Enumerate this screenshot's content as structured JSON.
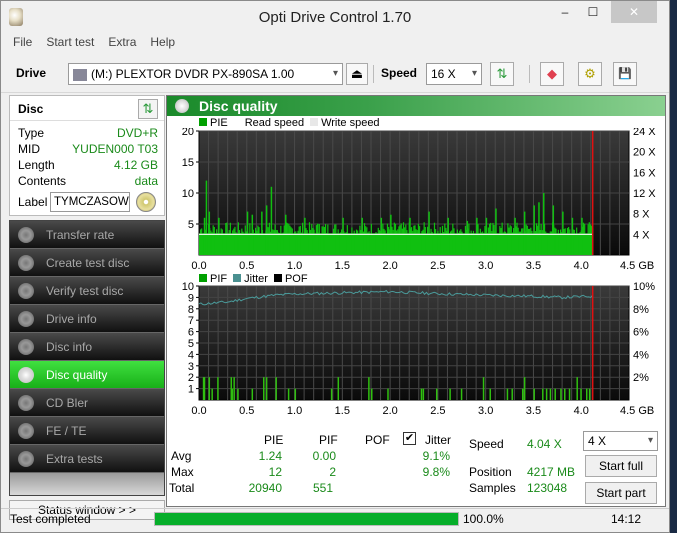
{
  "window": {
    "title": "Opti Drive Control 1.70",
    "minimize": "‒",
    "maximize": "☐",
    "close": "✕"
  },
  "menu": [
    "File",
    "Start test",
    "Extra",
    "Help"
  ],
  "toolbar": {
    "drive_label": "Drive",
    "drive_value": "(M:)  PLEXTOR DVDR   PX-890SA 1.00",
    "eject_icon": "⏏",
    "speed_label": "Speed",
    "speed_value": "16 X",
    "refresh_icon": "⇅",
    "erase_icon": "◆",
    "settings_icon": "⚙",
    "save_icon": "💾"
  },
  "disc": {
    "title": "Disc",
    "refresh_icon": "⇅",
    "rows": [
      {
        "key": "Type",
        "value": "DVD+R"
      },
      {
        "key": "MID",
        "value": "YUDEN000 T03"
      },
      {
        "key": "Length",
        "value": "4.12 GB"
      },
      {
        "key": "Contents",
        "value": "data"
      }
    ],
    "label_key": "Label",
    "label_value": "TYMCZASOWK"
  },
  "nav": [
    {
      "label": "Transfer rate",
      "active": false
    },
    {
      "label": "Create test disc",
      "active": false
    },
    {
      "label": "Verify test disc",
      "active": false
    },
    {
      "label": "Drive info",
      "active": false
    },
    {
      "label": "Disc info",
      "active": false
    },
    {
      "label": "Disc quality",
      "active": true
    },
    {
      "label": "CD Bler",
      "active": false
    },
    {
      "label": "FE / TE",
      "active": false
    },
    {
      "label": "Extra tests",
      "active": false
    }
  ],
  "status_window_button": "Status window > >",
  "panel": {
    "title": "Disc quality"
  },
  "chart_data": [
    {
      "type": "bar",
      "title": "PIE",
      "legend": [
        "PIE",
        "Read speed",
        "Write speed"
      ],
      "legend_colors": {
        "PIE": "#00a000",
        "Read speed": "#ffffff",
        "Write speed": "#e8e8e8"
      },
      "xlabel": "GB",
      "x_ticks": [
        "0.0",
        "0.5",
        "1.0",
        "1.5",
        "2.0",
        "2.5",
        "3.0",
        "3.5",
        "4.0",
        "4.5 GB"
      ],
      "xlim": [
        0,
        4.5
      ],
      "y_ticks": [
        "5",
        "10",
        "15",
        "20"
      ],
      "ylim": [
        0,
        20
      ],
      "y2_ticks": [
        "4 X",
        "8 X",
        "12 X",
        "16 X",
        "20 X",
        "24 X"
      ],
      "y2lim": [
        0,
        24
      ],
      "end_marker_gb": 4.12,
      "pie_baseline": 3.5,
      "pie_peaks": [
        [
          0.07,
          12
        ],
        [
          0.05,
          6
        ],
        [
          0.1,
          7
        ],
        [
          0.2,
          6
        ],
        [
          0.5,
          7
        ],
        [
          0.55,
          6.5
        ],
        [
          0.65,
          7
        ],
        [
          0.7,
          8
        ],
        [
          0.75,
          11
        ],
        [
          0.9,
          6.5
        ],
        [
          1.1,
          6
        ],
        [
          1.25,
          5
        ],
        [
          1.5,
          6
        ],
        [
          1.7,
          6
        ],
        [
          1.9,
          6
        ],
        [
          2.0,
          6.5
        ],
        [
          2.2,
          6
        ],
        [
          2.4,
          7
        ],
        [
          2.6,
          6
        ],
        [
          2.8,
          5.5
        ],
        [
          2.9,
          6
        ],
        [
          3.0,
          6
        ],
        [
          3.1,
          7.5
        ],
        [
          3.3,
          6
        ],
        [
          3.4,
          7
        ],
        [
          3.5,
          8
        ],
        [
          3.55,
          8.5
        ],
        [
          3.6,
          10
        ],
        [
          3.7,
          8
        ],
        [
          3.8,
          7
        ],
        [
          3.9,
          6
        ],
        [
          4.0,
          6
        ]
      ],
      "read_speed_x": 4.0
    },
    {
      "type": "bar",
      "title": "PIF / Jitter",
      "legend": [
        "PIF",
        "Jitter",
        "POF"
      ],
      "legend_colors": {
        "PIF": "#00a000",
        "Jitter": "#4a9090",
        "POF": "#000000"
      },
      "xlabel": "GB",
      "x_ticks": [
        "0.0",
        "0.5",
        "1.0",
        "1.5",
        "2.0",
        "2.5",
        "3.0",
        "3.5",
        "4.0",
        "4.5 GB"
      ],
      "xlim": [
        0,
        4.5
      ],
      "y_ticks": [
        "1",
        "2",
        "3",
        "4",
        "5",
        "6",
        "7",
        "8",
        "9",
        "10"
      ],
      "ylim": [
        0,
        10
      ],
      "y2_ticks": [
        "2%",
        "4%",
        "6%",
        "8%",
        "10%"
      ],
      "y2lim": [
        0,
        10
      ],
      "end_marker_gb": 4.12,
      "pif_bars": [
        [
          0.04,
          2
        ],
        [
          0.05,
          2
        ],
        [
          0.1,
          2
        ],
        [
          0.13,
          1
        ],
        [
          0.19,
          2
        ],
        [
          0.33,
          2
        ],
        [
          0.34,
          1
        ],
        [
          0.36,
          2
        ],
        [
          0.4,
          1
        ],
        [
          0.55,
          1
        ],
        [
          0.67,
          2
        ],
        [
          0.7,
          2
        ],
        [
          0.8,
          2
        ],
        [
          0.93,
          1
        ],
        [
          1.0,
          1
        ],
        [
          1.38,
          1
        ],
        [
          1.45,
          2
        ],
        [
          1.77,
          2
        ],
        [
          1.8,
          1
        ],
        [
          1.97,
          1
        ],
        [
          2.32,
          1
        ],
        [
          2.34,
          1
        ],
        [
          2.48,
          1
        ],
        [
          2.62,
          1
        ],
        [
          2.74,
          1
        ],
        [
          2.97,
          2
        ],
        [
          3.04,
          1
        ],
        [
          3.22,
          1
        ],
        [
          3.27,
          1
        ],
        [
          3.38,
          1
        ],
        [
          3.4,
          2
        ],
        [
          3.5,
          1
        ],
        [
          3.59,
          1
        ],
        [
          3.63,
          1
        ],
        [
          3.67,
          1
        ],
        [
          3.72,
          1
        ],
        [
          3.78,
          1
        ],
        [
          3.82,
          1
        ],
        [
          3.87,
          1
        ],
        [
          3.95,
          2
        ],
        [
          3.99,
          1
        ],
        [
          4.05,
          1
        ],
        [
          4.08,
          1
        ]
      ],
      "jitter_points": [
        [
          0.0,
          8.4
        ],
        [
          0.3,
          8.6
        ],
        [
          0.5,
          8.9
        ],
        [
          0.8,
          9.2
        ],
        [
          1.0,
          9.3
        ],
        [
          1.5,
          9.4
        ],
        [
          2.0,
          9.5
        ],
        [
          2.3,
          9.4
        ],
        [
          2.6,
          9.3
        ],
        [
          3.0,
          9.2
        ],
        [
          3.5,
          9.1
        ],
        [
          3.8,
          9.0
        ],
        [
          4.1,
          9.1
        ]
      ]
    }
  ],
  "stats": {
    "headers": [
      "PIE",
      "PIF",
      "POF",
      "Jitter"
    ],
    "jitter_checked": true,
    "rows": [
      {
        "label": "Avg",
        "pie": "1.24",
        "pif": "0.00",
        "pof": "",
        "jitter": "9.1%"
      },
      {
        "label": "Max",
        "pie": "12",
        "pif": "2",
        "pof": "",
        "jitter": "9.8%"
      },
      {
        "label": "Total",
        "pie": "20940",
        "pif": "551",
        "pof": "",
        "jitter": ""
      }
    ]
  },
  "info": {
    "speed_label": "Speed",
    "speed_value": "4.04 X",
    "position_label": "Position",
    "position_value": "4217 MB",
    "samples_label": "Samples",
    "samples_value": "123048"
  },
  "controls": {
    "speed_select": "4 X",
    "start_full": "Start full",
    "start_part": "Start part"
  },
  "statusbar": {
    "text": "Test completed",
    "progress_percent": 100,
    "progress_text": "100.0%",
    "time": "14:12"
  }
}
